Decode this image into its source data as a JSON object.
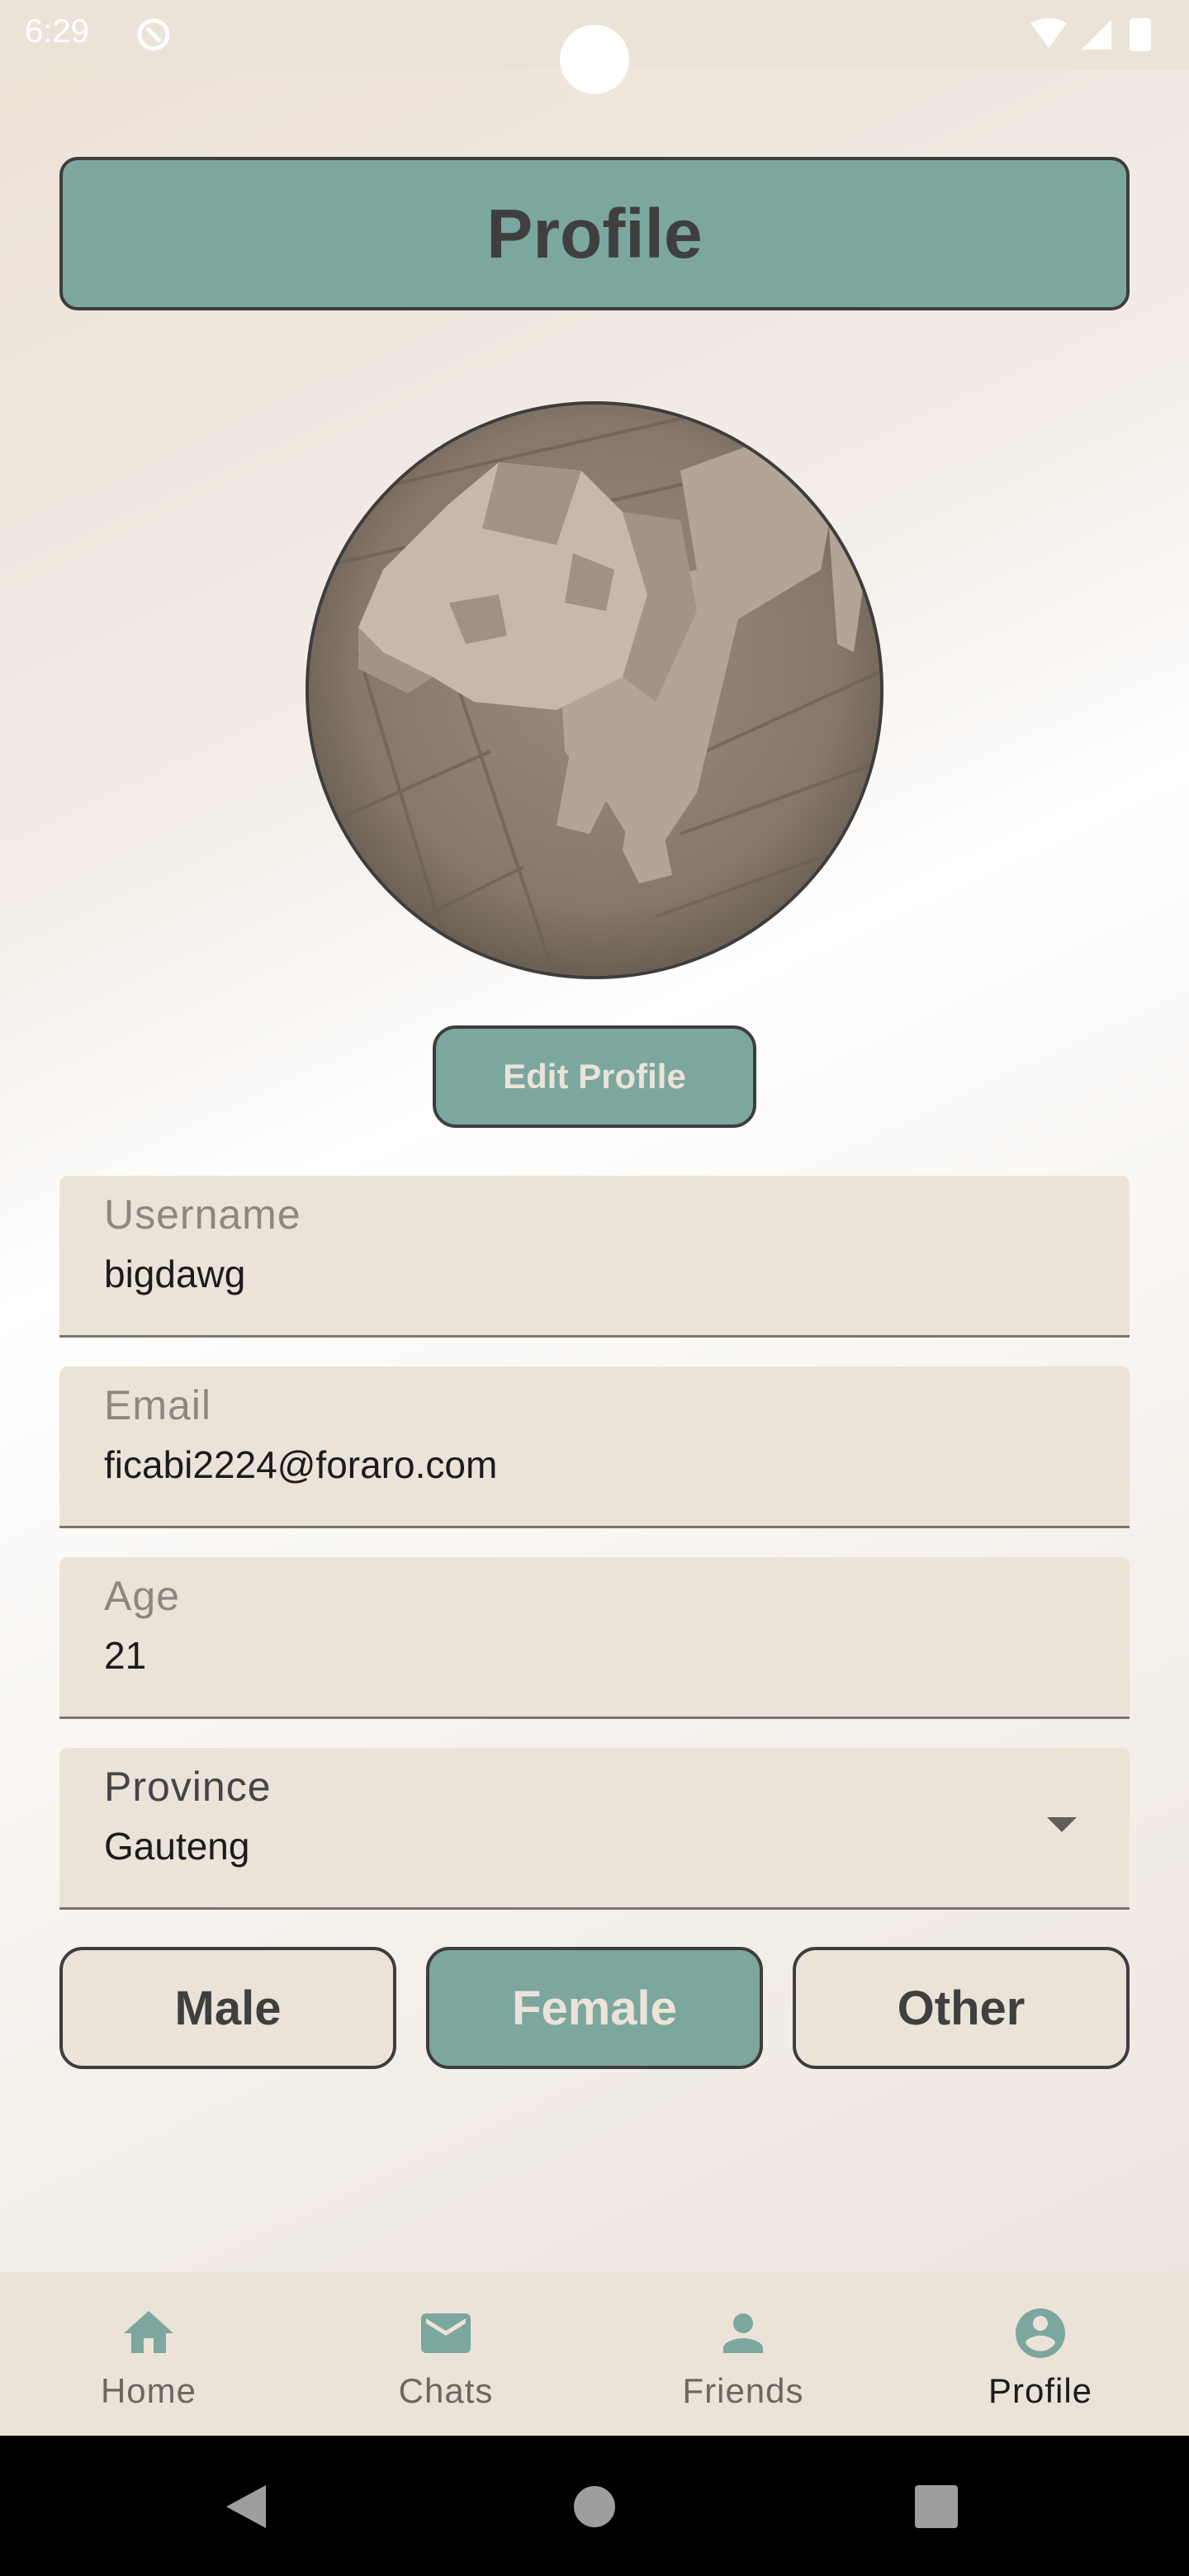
{
  "status_bar": {
    "time": "6:29"
  },
  "header": {
    "title": "Profile"
  },
  "avatar": {
    "alt": "Profile picture"
  },
  "edit_button": {
    "label": "Edit Profile"
  },
  "fields": {
    "username": {
      "label": "Username",
      "value": "bigdawg"
    },
    "email": {
      "label": "Email",
      "value": "ficabi2224@foraro.com"
    },
    "age": {
      "label": "Age",
      "value": "21"
    },
    "province": {
      "label": "Province",
      "value": "Gauteng"
    }
  },
  "gender": {
    "options": [
      "Male",
      "Female",
      "Other"
    ],
    "selected": "Female"
  },
  "bottom_nav": {
    "items": [
      {
        "label": "Home",
        "icon": "home-icon"
      },
      {
        "label": "Chats",
        "icon": "mail-icon"
      },
      {
        "label": "Friends",
        "icon": "person-icon"
      },
      {
        "label": "Profile",
        "icon": "account-circle-icon"
      }
    ],
    "active": "Profile"
  },
  "colors": {
    "accent": "#7ba79f",
    "surface": "#ece3d8",
    "border": "#3d3d3d",
    "text_dark": "#3f3f3f"
  }
}
